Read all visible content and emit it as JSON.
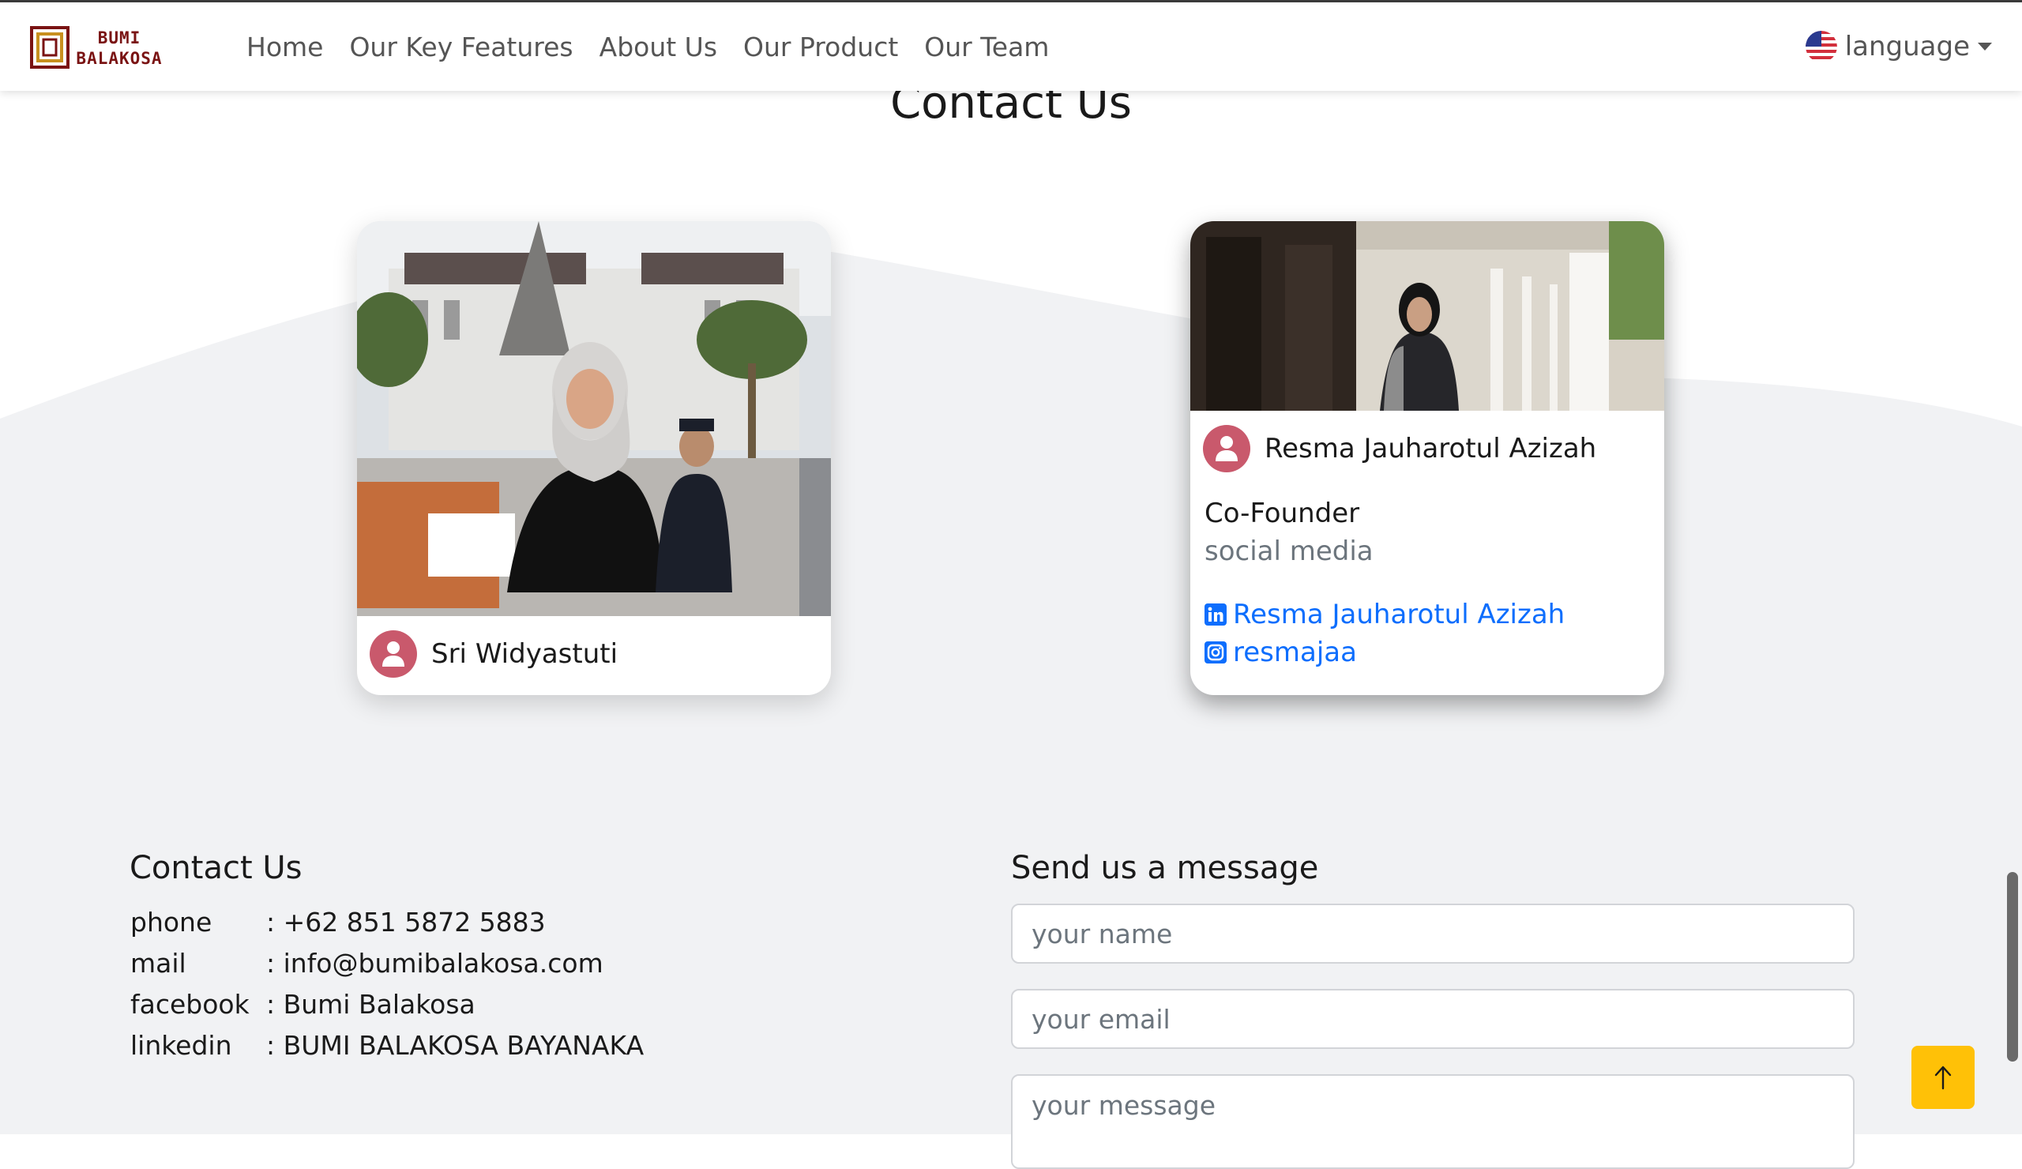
{
  "brand": {
    "name_line1": "BUMI",
    "name_line2": "BALAKOSA",
    "colors": {
      "logo": "#7a1313",
      "logo_gold": "#c8901f"
    }
  },
  "nav": {
    "items": [
      {
        "label": "Home"
      },
      {
        "label": "Our Key Features"
      },
      {
        "label": "About Us"
      },
      {
        "label": "Our Product"
      },
      {
        "label": "Our Team"
      }
    ],
    "language": {
      "label": "language",
      "flag_icon": "us-flag-icon"
    }
  },
  "contacts_section": {
    "title": "Contact Us",
    "cards": [
      {
        "name": "Sri Widyastuti",
        "avatar_icon": "user-icon"
      },
      {
        "name": "Resma Jauharotul Azizah",
        "role": "Co-Founder",
        "department": "social media",
        "linkedin": "Resma Jauharotul Azizah",
        "instagram": "resmajaa"
      }
    ]
  },
  "footer": {
    "contact": {
      "title": "Contact Us",
      "rows": [
        {
          "label": "phone",
          "value": ": +62 851 5872 5883"
        },
        {
          "label": "mail",
          "value": ": info@bumibalakosa.com"
        },
        {
          "label": "facebook",
          "value": ": Bumi Balakosa"
        },
        {
          "label": "linkedin",
          "value": ": BUMI BALAKOSA BAYANAKA"
        }
      ]
    },
    "message": {
      "title": "Send us a message",
      "name_placeholder": "your name",
      "email_placeholder": "your email",
      "message_placeholder": "your message"
    }
  },
  "colors": {
    "link": "#0d6efd",
    "avatar": "#c9596c",
    "back_to_top": "#ffc107",
    "background_wave": "#f1f2f4"
  },
  "back_to_top": {
    "icon": "arrow-up-icon"
  }
}
